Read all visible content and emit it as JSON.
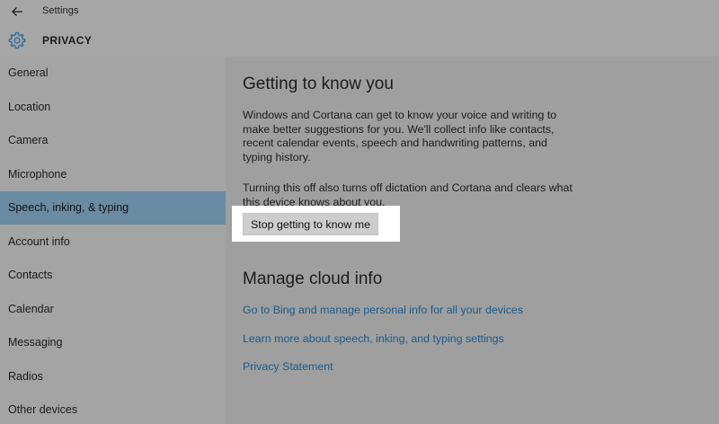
{
  "window": {
    "title": "Settings"
  },
  "header": {
    "title": "PRIVACY",
    "icon": "gear-icon"
  },
  "sidebar": {
    "selected_index": 4,
    "items": [
      {
        "label": "General"
      },
      {
        "label": "Location"
      },
      {
        "label": "Camera"
      },
      {
        "label": "Microphone"
      },
      {
        "label": "Speech, inking, & typing"
      },
      {
        "label": "Account info"
      },
      {
        "label": "Contacts"
      },
      {
        "label": "Calendar"
      },
      {
        "label": "Messaging"
      },
      {
        "label": "Radios"
      },
      {
        "label": "Other devices"
      }
    ]
  },
  "main": {
    "section1": {
      "heading": "Getting to know you",
      "paragraph1": "Windows and Cortana can get to know your voice and writing to make better suggestions for you. We'll collect info like contacts, recent calendar events, speech and handwriting patterns, and typing history.",
      "paragraph2": "Turning this off also turns off dictation and Cortana and clears what this device knows about you.",
      "button_label": "Stop getting to know me"
    },
    "section2": {
      "heading": "Manage cloud info",
      "links": [
        {
          "label": "Go to Bing and manage personal info for all your devices"
        },
        {
          "label": "Learn more about speech, inking, and typing settings"
        },
        {
          "label": "Privacy Statement"
        }
      ]
    }
  },
  "colors": {
    "accent": "#6a8ba2",
    "link": "#1b5a8a",
    "icon": "#2d6e9e"
  }
}
